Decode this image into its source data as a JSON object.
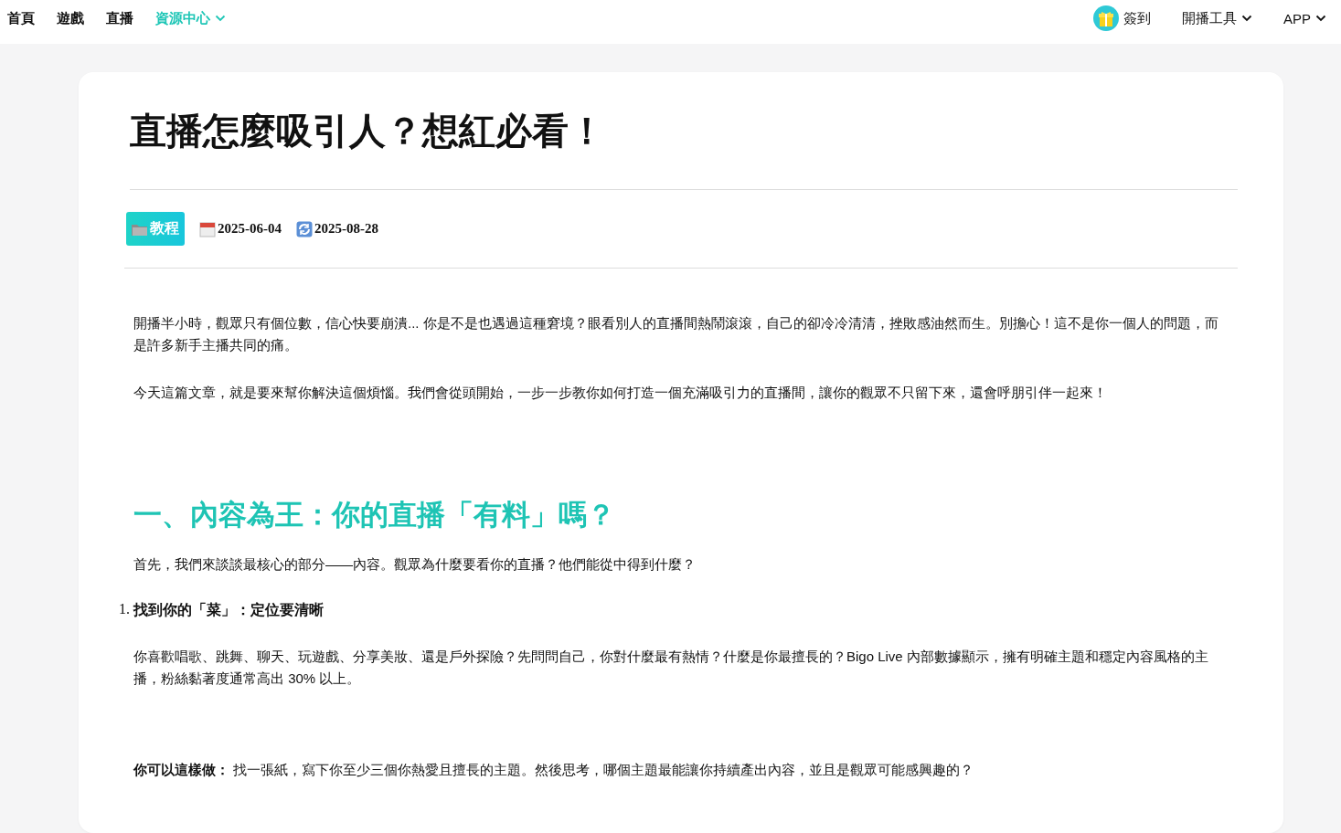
{
  "nav": {
    "left": [
      {
        "label": "首頁",
        "selected": false,
        "dropdown": false
      },
      {
        "label": "遊戲",
        "selected": false,
        "dropdown": false
      },
      {
        "label": "直播",
        "selected": false,
        "dropdown": false
      },
      {
        "label": "資源中心",
        "selected": true,
        "dropdown": true
      }
    ],
    "checkin": {
      "label": "簽到"
    },
    "right": [
      {
        "label": "開播工具",
        "dropdown": true
      },
      {
        "label": "APP",
        "dropdown": true
      }
    ]
  },
  "article": {
    "title": "直播怎麼吸引人？想紅必看！",
    "category": "教程",
    "published": "2025-06-04",
    "updated": "2025-08-28",
    "blocks": [
      {
        "kind": "paragraph",
        "text": "開播半小時，觀眾只有個位數，信心快要崩潰... 你是不是也遇過這種窘境？眼看別人的直播間熱鬧滾滾，自己的卻冷冷清清，挫敗感油然而生。別擔心！這不是你一個人的問題，而是許多新手主播共同的痛。"
      },
      {
        "kind": "paragraph",
        "text": "今天這篇文章，就是要來幫你解決這個煩惱。我們會從頭開始，一步一步教你如何打造一個充滿吸引力的直播間，讓你的觀眾不只留下來，還會呼朋引伴一起來！"
      },
      {
        "kind": "heading",
        "text": "一、內容為王：你的直播「有料」嗎？"
      },
      {
        "kind": "paragraph",
        "text": "首先，我們來談談最核心的部分——內容。觀眾為什麼要看你的直播？他們能從中得到什麼？"
      },
      {
        "kind": "list-item",
        "number": "1.",
        "text": "找到你的「菜」：定位要清晰"
      },
      {
        "kind": "paragraph",
        "text": "你喜歡唱歌、跳舞、聊天、玩遊戲、分享美妝、還是戶外探險？先問問自己，你對什麼最有熱情？什麼是你最擅長的？Bigo Live 內部數據顯示，擁有明確主題和穩定內容風格的主播，粉絲黏著度通常高出 30% 以上。"
      },
      {
        "kind": "tip",
        "text": "**你可以這樣做：** 找一張紙，寫下你至少三個你熱愛且擅長的主題。然後思考，哪個主題最能讓你持續產出內容，並且是觀眾可能感興趣的？"
      }
    ]
  }
}
